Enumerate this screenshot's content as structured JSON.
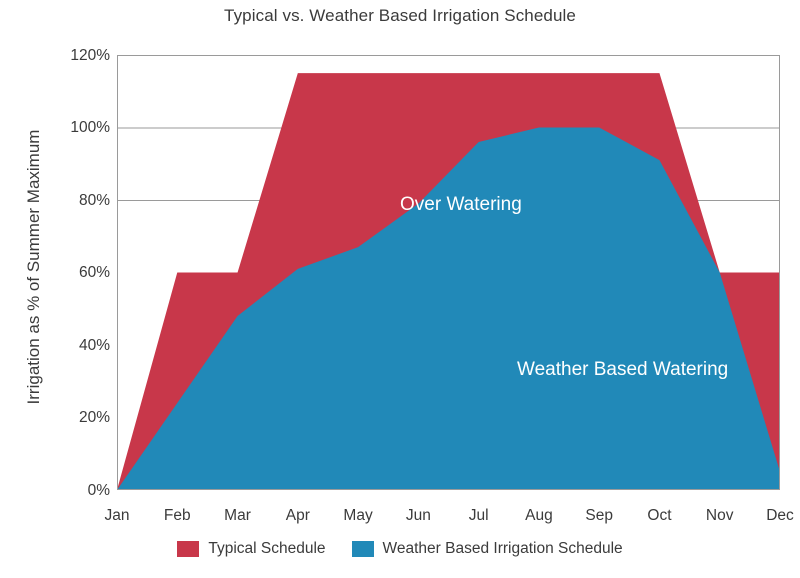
{
  "chart_data": {
    "type": "area",
    "title": "Typical vs. Weather Based Irrigation Schedule",
    "xlabel": "",
    "ylabel": "Irrigation as % of Summer Maximum",
    "categories": [
      "Jan",
      "Feb",
      "Mar",
      "Apr",
      "May",
      "Jun",
      "Jul",
      "Aug",
      "Sep",
      "Oct",
      "Nov",
      "Dec"
    ],
    "series": [
      {
        "name": "Typical Schedule",
        "color": "#c8374a",
        "values": [
          0,
          60,
          60,
          115,
          115,
          115,
          115,
          115,
          115,
          115,
          60,
          60
        ]
      },
      {
        "name": "Weather Based Irrigation Schedule",
        "color": "#2189b8",
        "values": [
          0,
          24,
          48,
          61,
          67,
          79,
          96,
          100,
          100,
          91,
          60,
          5
        ]
      }
    ],
    "ylim": [
      0,
      120
    ],
    "y_ticks": [
      "0%",
      "20%",
      "40%",
      "60%",
      "80%",
      "100%",
      "120%"
    ],
    "y_tick_values": [
      0,
      20,
      40,
      60,
      80,
      100,
      120
    ],
    "grid": "horizontal",
    "gridlines_at": [
      80,
      100,
      120
    ],
    "legend_position": "bottom",
    "annotations": [
      {
        "text": "Over Watering",
        "color": "#ffffff",
        "region": "typical-schedule-area"
      },
      {
        "text": "Weather Based Watering",
        "color": "#ffffff",
        "region": "weather-based-area"
      }
    ],
    "colors": {
      "typical_schedule": "#c8374a",
      "weather_based": "#2189b8",
      "axis": "#9a9a9a",
      "text": "#3b3b3b",
      "background": "#ffffff"
    }
  }
}
